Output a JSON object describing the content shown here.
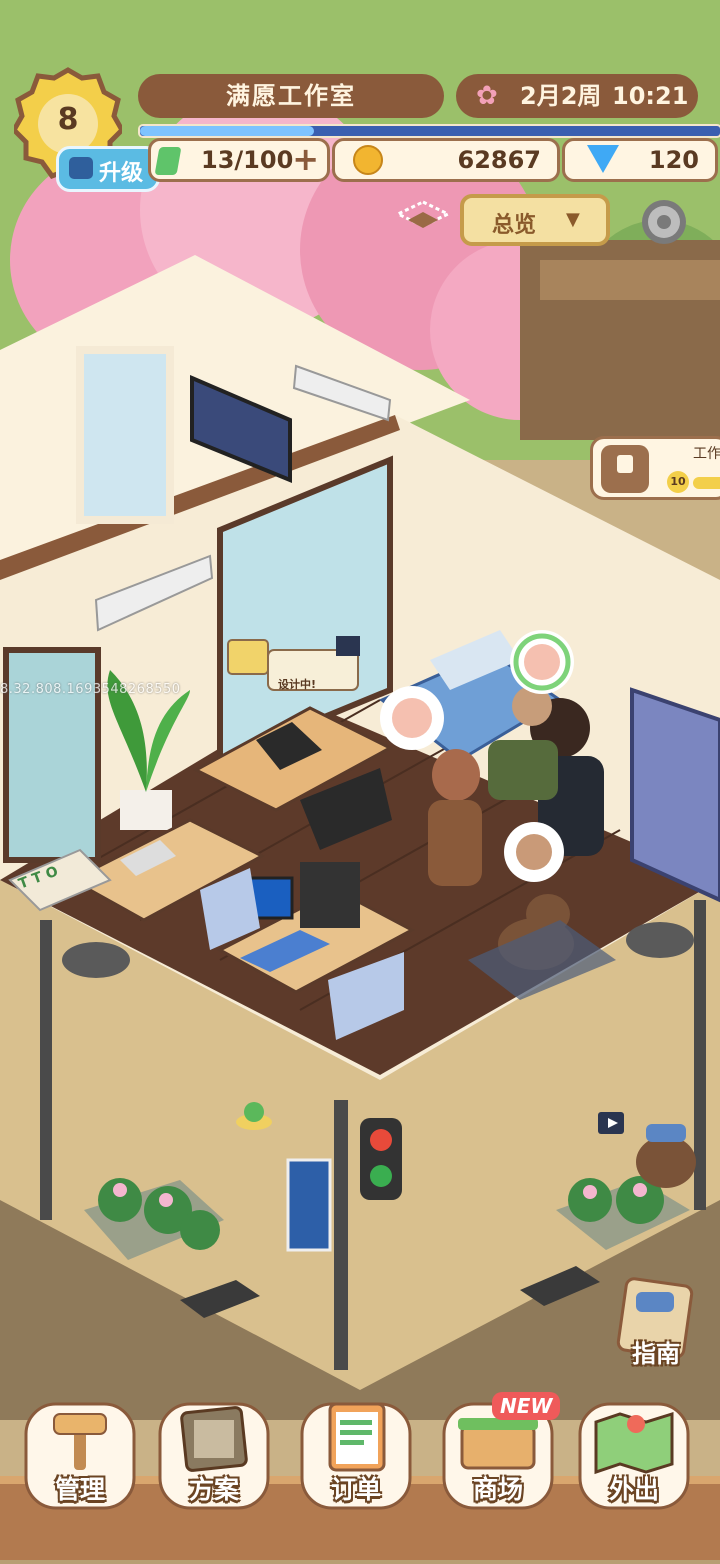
{
  "hud": {
    "level": "8",
    "upgrade_label": "升级",
    "studio_name": "满愿工作室",
    "date": "2月2周",
    "time": "10:21",
    "energy": "13/100",
    "coins": "62867",
    "gems": "120",
    "overview_label": "总览",
    "locked_area_label": "工作",
    "locked_area_level": "10"
  },
  "scene": {
    "status_bubble": "设计中!",
    "debug_overlay": "8.32.808.1693548268550",
    "sign_text": "T T O"
  },
  "side": {
    "guide_label": "指南"
  },
  "nav": {
    "items": [
      {
        "label": "管理",
        "icon": "hammer-icon"
      },
      {
        "label": "方案",
        "icon": "blueprint-icon"
      },
      {
        "label": "订单",
        "icon": "clipboard-icon"
      },
      {
        "label": "商场",
        "icon": "shop-basket-icon",
        "badge": "NEW"
      },
      {
        "label": "外出",
        "icon": "map-icon"
      }
    ]
  },
  "colors": {
    "wood": "#8a5a3b",
    "cream": "#fff5e2",
    "blossom": "#f3a1b8",
    "gem": "#3fa9f5",
    "coin": "#f2b530"
  }
}
